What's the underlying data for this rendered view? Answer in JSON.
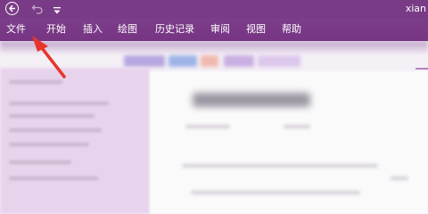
{
  "titlebar": {
    "back_icon": "back-arrow-icon",
    "undo_icon": "undo-icon",
    "customize_icon": "customize-quick-access-icon",
    "user_name": "xian"
  },
  "ribbon": {
    "tabs": [
      {
        "label": "文件"
      },
      {
        "label": "开始"
      },
      {
        "label": "插入"
      },
      {
        "label": "绘图"
      },
      {
        "label": "历史记录"
      },
      {
        "label": "审阅"
      },
      {
        "label": "视图"
      },
      {
        "label": "帮助"
      }
    ]
  },
  "annotation": {
    "color": "#e8342c"
  },
  "colors": {
    "ribbon": "#7a3b86",
    "sidebar": "#e8d3ec",
    "page": "#fbfafb"
  }
}
